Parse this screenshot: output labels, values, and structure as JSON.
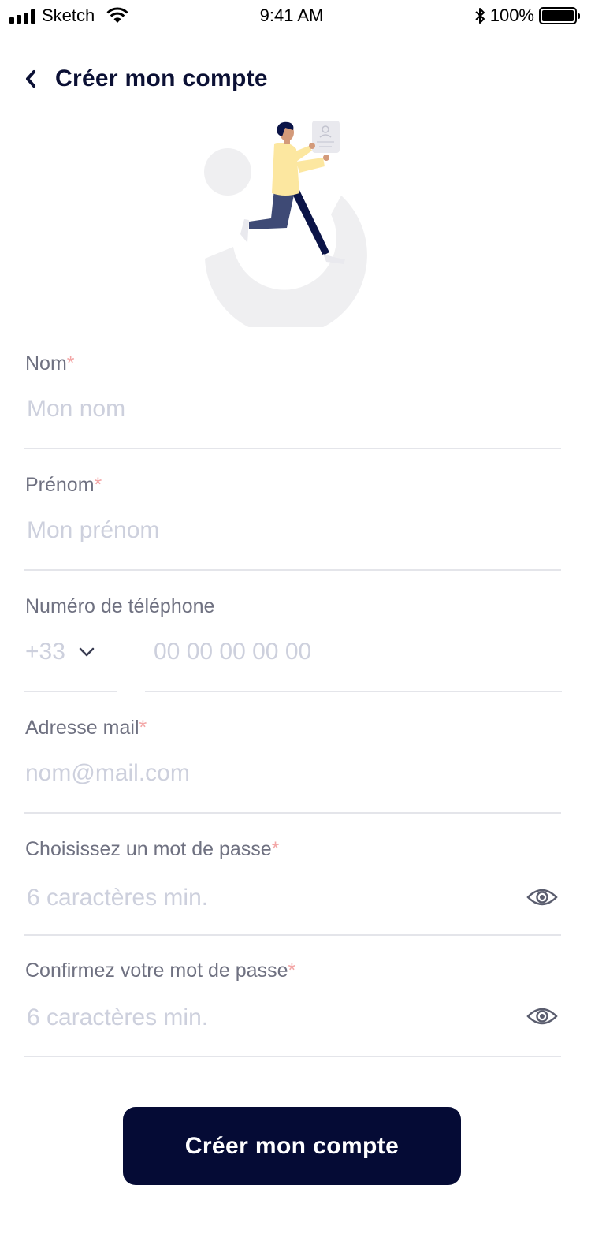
{
  "status_bar": {
    "carrier": "Sketch",
    "time": "9:41 AM",
    "battery": "100%"
  },
  "header": {
    "title": "Créer mon compte",
    "back_icon": "chevron-left-icon"
  },
  "form": {
    "nom": {
      "label": "Nom",
      "required_mark": "*",
      "placeholder": "Mon nom"
    },
    "prenom": {
      "label": "Prénom",
      "required_mark": "*",
      "placeholder": "Mon prénom"
    },
    "telephone": {
      "label": "Numéro de téléphone",
      "country_code": "+33",
      "placeholder": "00 00 00 00 00"
    },
    "email": {
      "label": "Adresse mail",
      "required_mark": "*",
      "placeholder": "nom@mail.com"
    },
    "password": {
      "label": "Choisissez un mot de passe",
      "required_mark": "*",
      "placeholder": "6 caractères min."
    },
    "password_confirm": {
      "label": "Confirmez votre mot de passe",
      "required_mark": "*",
      "placeholder": "6 caractères min."
    }
  },
  "submit_label": "Créer mon compte",
  "colors": {
    "primary": "#050b35",
    "label": "#6f7181",
    "placeholder": "#cdd0dd",
    "required": "#f3a6a6",
    "divider": "#e4e5ea"
  }
}
